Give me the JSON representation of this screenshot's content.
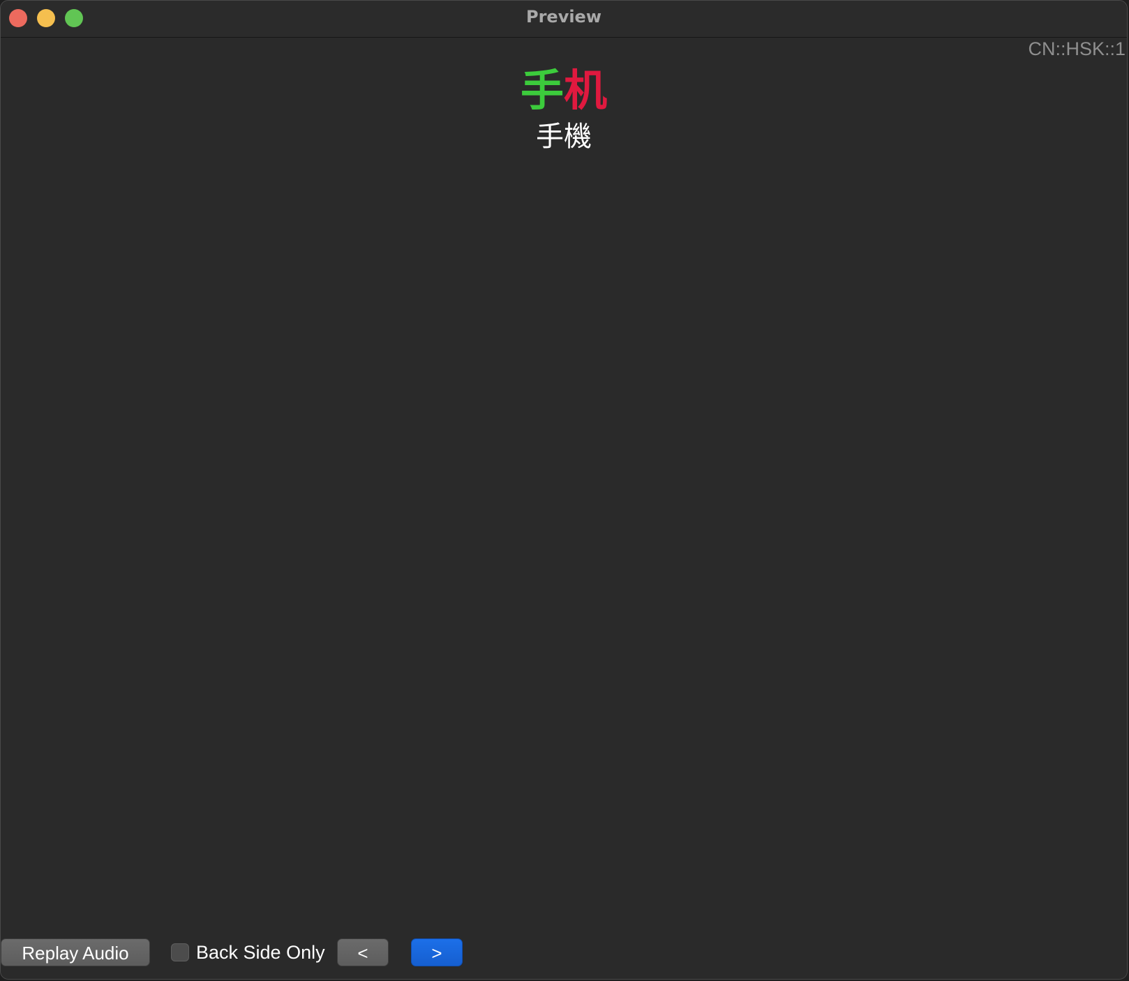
{
  "window": {
    "title": "Preview",
    "controls": {
      "close_color": "#ed6a5e",
      "minimize_color": "#f5bf4f",
      "zoom_color": "#61c554"
    }
  },
  "card": {
    "deck_tag": "CN::HSK::1",
    "simplified_chars": [
      {
        "char": "手",
        "color": "#3ccb3c"
      },
      {
        "char": "机",
        "color": "#e0193f"
      }
    ],
    "traditional": "手機"
  },
  "toolbar": {
    "replay_label": "Replay Audio",
    "back_side_only_label": "Back Side Only",
    "back_side_only_checked": false,
    "prev_label": "<",
    "next_label": ">"
  }
}
